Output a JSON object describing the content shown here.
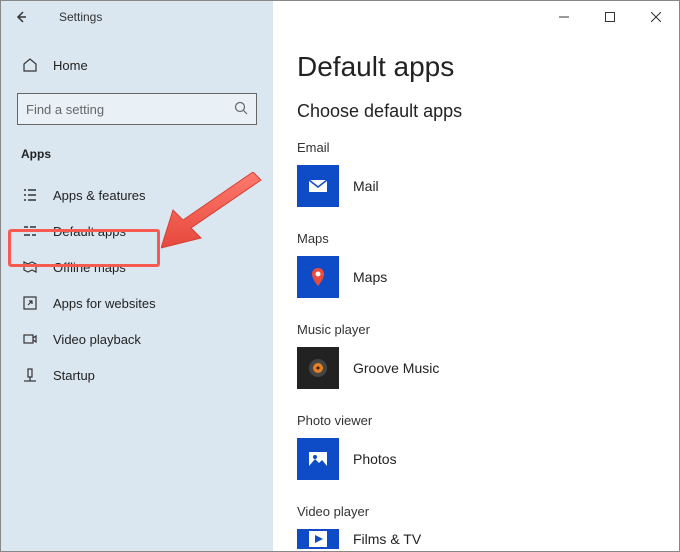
{
  "window": {
    "title": "Settings"
  },
  "sidebar": {
    "home_label": "Home",
    "search_placeholder": "Find a setting",
    "section_label": "Apps",
    "items": [
      {
        "label": "Apps & features"
      },
      {
        "label": "Default apps"
      },
      {
        "label": "Offline maps"
      },
      {
        "label": "Apps for websites"
      },
      {
        "label": "Video playback"
      },
      {
        "label": "Startup"
      }
    ]
  },
  "main": {
    "title": "Default apps",
    "subtitle": "Choose default apps",
    "groups": [
      {
        "category": "Email",
        "app": "Mail"
      },
      {
        "category": "Maps",
        "app": "Maps"
      },
      {
        "category": "Music player",
        "app": "Groove Music"
      },
      {
        "category": "Photo viewer",
        "app": "Photos"
      },
      {
        "category": "Video player",
        "app": "Films & TV"
      }
    ]
  },
  "annotation": {
    "highlight_color": "#f75b4f"
  }
}
